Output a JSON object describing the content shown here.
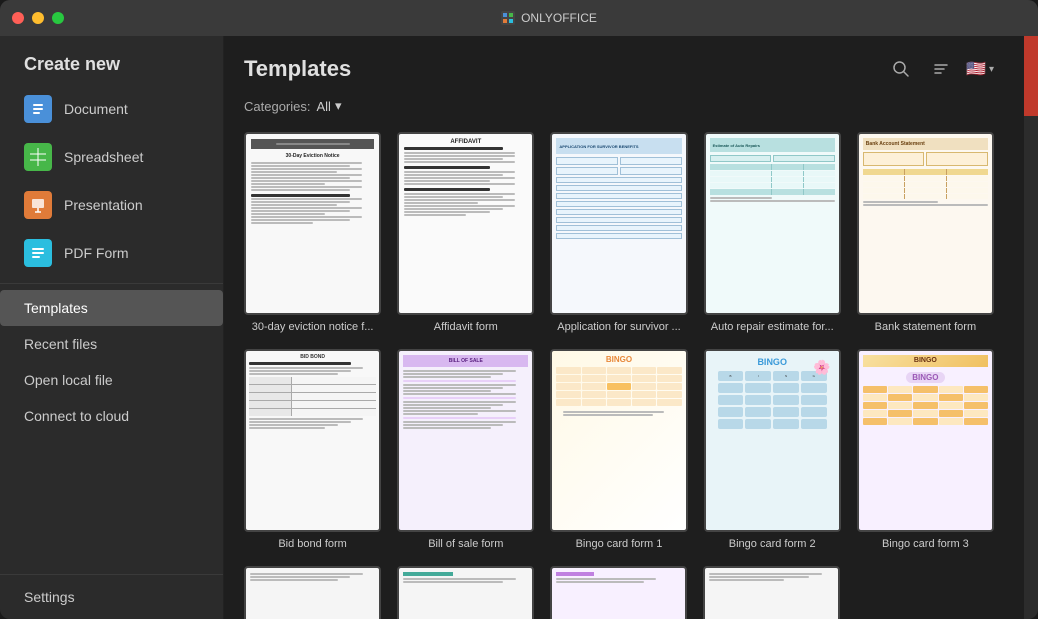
{
  "window": {
    "title": "ONLYOFFICE"
  },
  "sidebar": {
    "create_new_label": "Create new",
    "items": [
      {
        "id": "document",
        "label": "Document",
        "icon": "doc"
      },
      {
        "id": "spreadsheet",
        "label": "Spreadsheet",
        "icon": "sheet"
      },
      {
        "id": "presentation",
        "label": "Presentation",
        "icon": "pres"
      },
      {
        "id": "pdf-form",
        "label": "PDF Form",
        "icon": "pdf"
      }
    ],
    "nav_items": [
      {
        "id": "templates",
        "label": "Templates",
        "active": true
      },
      {
        "id": "recent-files",
        "label": "Recent files",
        "active": false
      },
      {
        "id": "open-local-file",
        "label": "Open local file",
        "active": false
      },
      {
        "id": "connect-to-cloud",
        "label": "Connect to cloud",
        "active": false
      }
    ],
    "settings_label": "Settings"
  },
  "templates": {
    "title": "Templates",
    "categories_label": "Categories:",
    "items": [
      {
        "id": "30day",
        "label": "30-day eviction notice f..."
      },
      {
        "id": "affidavit",
        "label": "Affidavit form"
      },
      {
        "id": "application",
        "label": "Application for survivor ..."
      },
      {
        "id": "autorepair",
        "label": "Auto repair estimate for..."
      },
      {
        "id": "bank",
        "label": "Bank statement form"
      },
      {
        "id": "bidbond",
        "label": "Bid bond form"
      },
      {
        "id": "billsale",
        "label": "Bill of sale form"
      },
      {
        "id": "bingo1",
        "label": "Bingo card form 1"
      },
      {
        "id": "bingo2",
        "label": "Bingo card form 2"
      },
      {
        "id": "bingo3",
        "label": "Bingo card form 3"
      }
    ]
  },
  "icons": {
    "search": "🔍",
    "sort": "⇅",
    "flag": "🇺🇸",
    "chevron_down": "▾",
    "doc_icon": "📄",
    "sheet_icon": "📊",
    "pres_icon": "📑",
    "pdf_icon": "📋"
  }
}
